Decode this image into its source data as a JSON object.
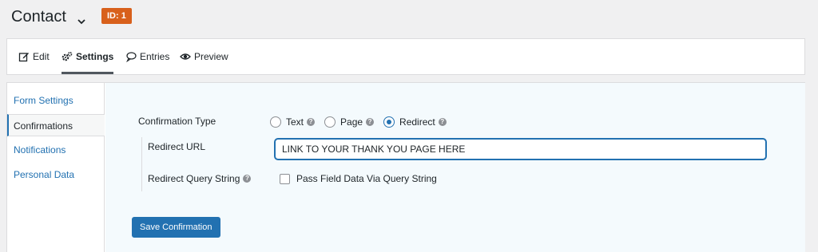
{
  "header": {
    "title": "Contact",
    "id_badge": "ID: 1"
  },
  "toolbar": {
    "tabs": [
      {
        "label": "Edit",
        "icon": "edit-icon"
      },
      {
        "label": "Settings",
        "icon": "gears-icon",
        "active": true
      },
      {
        "label": "Entries",
        "icon": "comment-icon"
      },
      {
        "label": "Preview",
        "icon": "eye-icon"
      }
    ]
  },
  "sidebar": {
    "items": [
      {
        "label": "Form Settings"
      },
      {
        "label": "Confirmations",
        "active": true
      },
      {
        "label": "Notifications"
      },
      {
        "label": "Personal Data"
      }
    ]
  },
  "confirmation": {
    "type_label": "Confirmation Type",
    "options": [
      {
        "label": "Text",
        "checked": false
      },
      {
        "label": "Page",
        "checked": false
      },
      {
        "label": "Redirect",
        "checked": true
      }
    ],
    "redirect_url_label": "Redirect URL",
    "redirect_url_value": "LINK TO YOUR THANK YOU PAGE HERE",
    "query_string_label": "Redirect Query String",
    "query_string_checkbox": "Pass Field Data Via Query String",
    "query_string_checked": false,
    "save_label": "Save Confirmation"
  },
  "colors": {
    "accent": "#2271b1",
    "badge": "#d8601b",
    "content_bg": "#f4fafd"
  }
}
